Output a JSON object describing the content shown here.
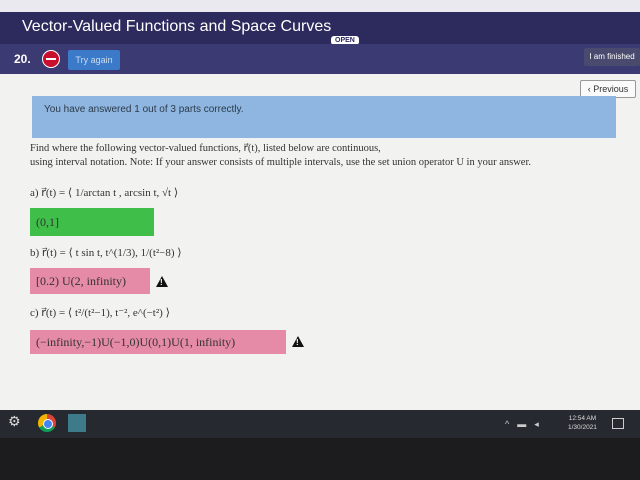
{
  "browser": {
    "icons": [
      "star-icon",
      "extension-icon",
      "puzzle-icon",
      "account-icon"
    ]
  },
  "header": {
    "title": "Vector-Valued Functions and Space Curves",
    "badge": "OPEN"
  },
  "toolbar": {
    "question_number": "20.",
    "try_again_label": "Try again",
    "finished_label": "I am finished"
  },
  "nav": {
    "previous_label": "‹ Previous"
  },
  "alert": {
    "text": "You have answered 1 out of 3 parts correctly."
  },
  "prompt": {
    "line1": "Find where the following vector-valued functions, r⃗(t), listed below are continuous,",
    "line2": "using interval notation. Note: If your answer consists of multiple intervals, use the set union operator U in your answer."
  },
  "parts": [
    {
      "label": "a) r⃗(t) = ⟨ 1/arctan t , arcsin t, √t ⟩",
      "answer": "(0,1]",
      "status": "correct"
    },
    {
      "label": "b) r⃗(t) = ⟨ t sin t, t^(1/3), 1/(t²−8) ⟩",
      "answer": "[0.2) U(2, infinity)",
      "status": "incorrect"
    },
    {
      "label": "c) r⃗(t) = ⟨ t²/(t²−1), t⁻², e^(−t²) ⟩",
      "answer": "(−infinity,−1)U(−1,0)U(0,1)U(1, infinity)",
      "status": "incorrect"
    }
  ],
  "taskbar": {
    "time": "12:54 AM",
    "date": "1/30/2021"
  },
  "colors": {
    "header": "#2d2a5e",
    "alert": "#8fb6e0",
    "correct": "#3fbf4a",
    "incorrect": "#e58aa7"
  }
}
